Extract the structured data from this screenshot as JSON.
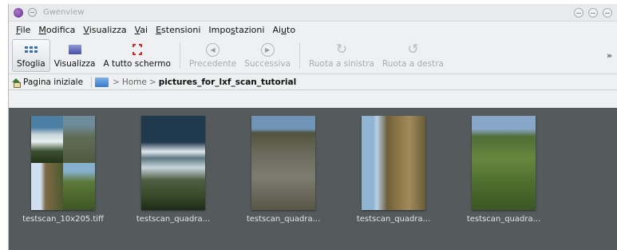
{
  "window": {
    "title": "Gwenview"
  },
  "menubar": {
    "items": [
      {
        "pre": "",
        "ul": "F",
        "post": "ile"
      },
      {
        "pre": "",
        "ul": "M",
        "post": "odifica"
      },
      {
        "pre": "",
        "ul": "V",
        "post": "isualizza"
      },
      {
        "pre": "",
        "ul": "V",
        "post": "ai"
      },
      {
        "pre": "",
        "ul": "E",
        "post": "stensioni"
      },
      {
        "pre": "Impo",
        "ul": "s",
        "post": "tazioni"
      },
      {
        "pre": "Ai",
        "ul": "u",
        "post": "to"
      }
    ]
  },
  "toolbar": {
    "browse": "Sfoglia",
    "view": "Visualizza",
    "fullscreen": "A tutto schermo",
    "previous": "Precedente",
    "next": "Successiva",
    "rotate_left": "Ruota a sinistra",
    "rotate_right": "Ruota a destra",
    "overflow": "»"
  },
  "location": {
    "home_label": "Pagina iniziale",
    "crumbs": [
      "Home",
      "pictures_for_lxf_scan_tutorial"
    ],
    "separator": ">"
  },
  "thumbnails": [
    {
      "label": "testscan_10x205.tiff"
    },
    {
      "label": "testscan_quadra..."
    },
    {
      "label": "testscan_quadra..."
    },
    {
      "label": "testscan_quadra..."
    },
    {
      "label": "testscan_quadra..."
    }
  ],
  "colors": {
    "browser_bg": "#555a5c",
    "chrome_bg": "#eef0f1",
    "thumb_label": "#e4e6e7"
  }
}
